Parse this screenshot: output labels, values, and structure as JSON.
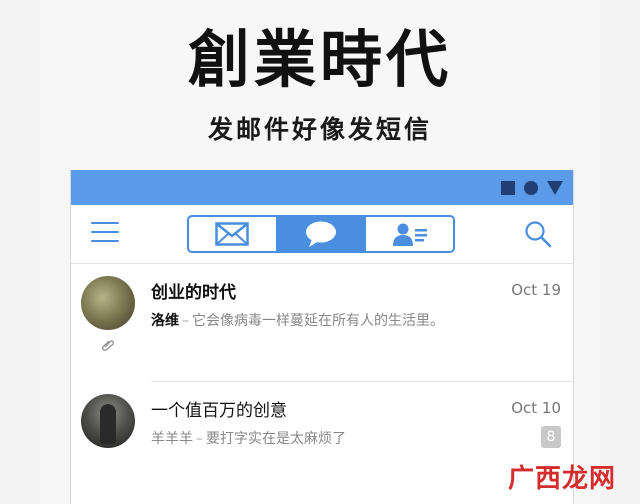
{
  "hero": {
    "title": "創業時代",
    "subtitle": "发邮件好像发短信"
  },
  "toolbar": {
    "tabs": [
      {
        "name": "mail",
        "icon": "envelope-icon",
        "active": false
      },
      {
        "name": "chat",
        "icon": "chat-bubble-icon",
        "active": true
      },
      {
        "name": "contacts",
        "icon": "contact-card-icon",
        "active": false
      }
    ]
  },
  "messages": [
    {
      "subject": "创业的时代",
      "sender": "洛维",
      "dash": "–",
      "preview": "它会像病毒一样蔓延在所有人的生活里。",
      "date": "Oct 19",
      "unread": true,
      "has_attachment": true
    },
    {
      "subject": "一个值百万的创意",
      "sender": "羊羊羊",
      "dash": "–",
      "preview": "要打字实在是太麻烦了",
      "date": "Oct 10",
      "unread": false,
      "badge": "8"
    }
  ],
  "watermark": "广西龙网",
  "colors": {
    "statusbar": "#5b9bea",
    "accent": "#4a8ee0",
    "status_icons": "#1f3e72"
  }
}
